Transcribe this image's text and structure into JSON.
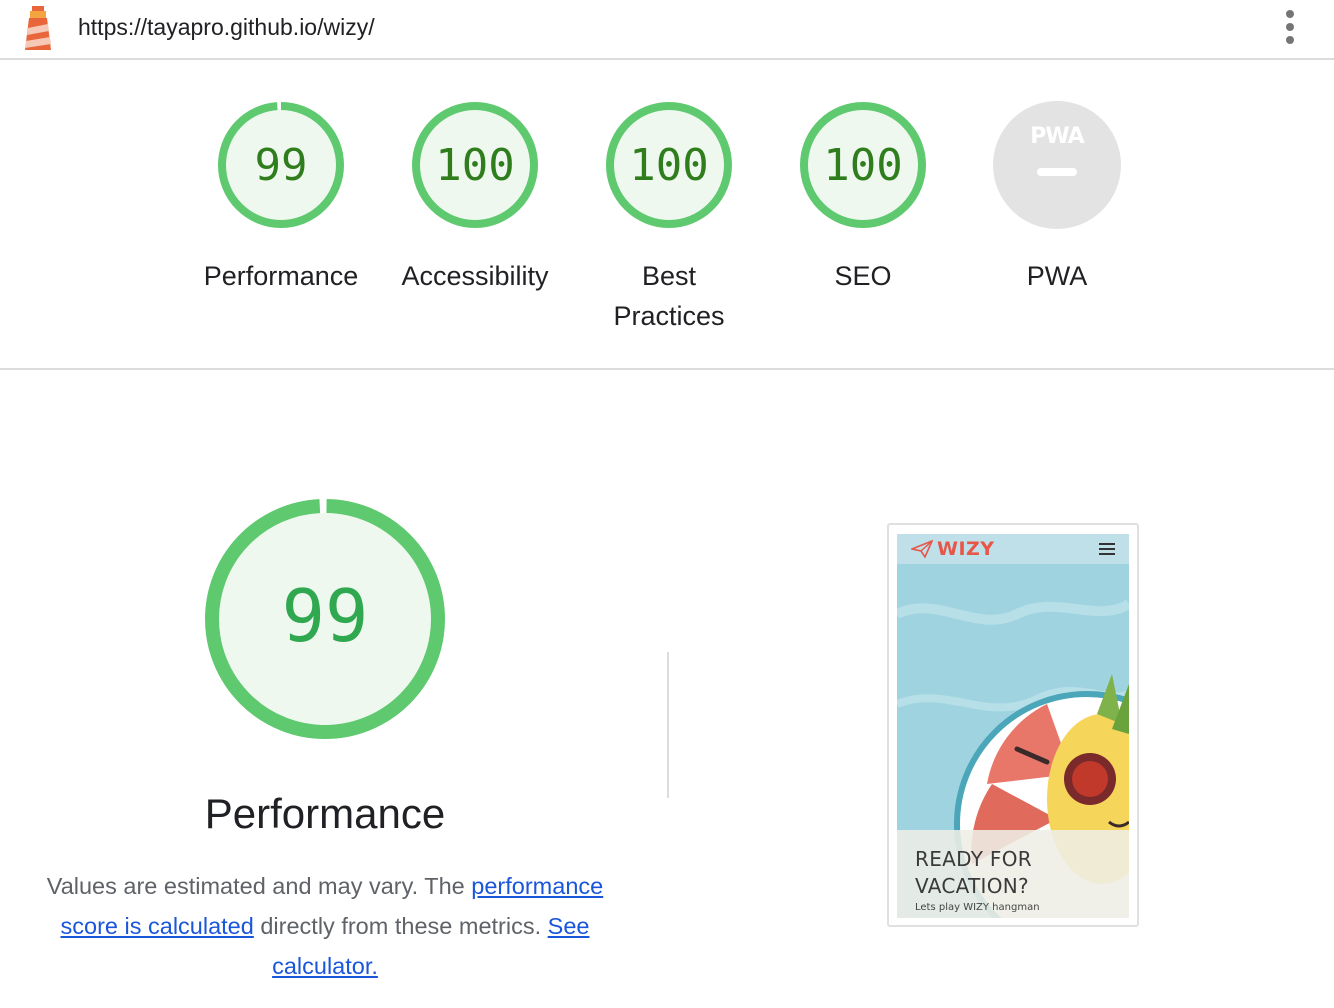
{
  "header": {
    "url": "https://tayapro.github.io/wizy/",
    "menu_icon": "more-vert-icon",
    "logo_icon": "lighthouse-icon"
  },
  "scores": [
    {
      "key": "performance",
      "label": "Performance",
      "value": 99,
      "display": "99"
    },
    {
      "key": "accessibility",
      "label": "Accessibility",
      "value": 100,
      "display": "100"
    },
    {
      "key": "best_practices",
      "label": "Best Practices",
      "value": 100,
      "display": "100"
    },
    {
      "key": "seo",
      "label": "SEO",
      "value": 100,
      "display": "100"
    },
    {
      "key": "pwa",
      "label": "PWA",
      "value": null,
      "display": "",
      "badge": "PWA"
    }
  ],
  "performance": {
    "score": 99,
    "display": "99",
    "title": "Performance",
    "desc_1": "Values are estimated and may vary. The ",
    "link_1": "performance score is calculated",
    "desc_2": " directly from these metrics. ",
    "link_2": "See calculator."
  },
  "screenshot": {
    "brand": "WIZY",
    "heading": "READY FOR VACATION?",
    "subtext": "Lets play WIZY hangman",
    "menu_icon": "hamburger-icon",
    "logo_icon": "paper-plane-icon"
  },
  "colors": {
    "pass_ring": "#5ec96e",
    "pass_fill": "#eef8ef",
    "pass_text": "#2f7d1d",
    "big_text": "#2fa84f",
    "pwa_fill": "#e3e3e3",
    "link": "#1a56db"
  }
}
